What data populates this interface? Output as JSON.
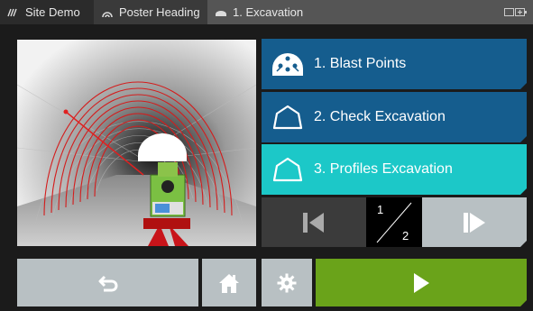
{
  "header": {
    "tabs": [
      {
        "label": "Site Demo",
        "icon": "site-icon"
      },
      {
        "label": "Poster Heading",
        "icon": "target-icon"
      },
      {
        "label": "1. Excavation",
        "icon": "tunnel-icon"
      }
    ],
    "battery_icon": "battery-icon"
  },
  "menu": {
    "items": [
      {
        "label": "1. Blast Points",
        "icon": "blast-points-icon"
      },
      {
        "label": "2. Check Excavation",
        "icon": "tunnel-profile-icon"
      },
      {
        "label": "3. Profiles Excavation",
        "icon": "tunnel-profile-icon"
      }
    ]
  },
  "pager": {
    "current": "1",
    "total": "2"
  },
  "colors": {
    "menu_blue": "#155d8e",
    "menu_cyan": "#1cc8c8",
    "start_green": "#6aa31a",
    "button_gray": "#b8c0c3",
    "dark_button": "#3b3b3b"
  },
  "footer": {
    "back_icon": "back-arrow-icon",
    "home_icon": "home-icon",
    "settings_icon": "gear-icon",
    "start_icon": "play-icon"
  }
}
